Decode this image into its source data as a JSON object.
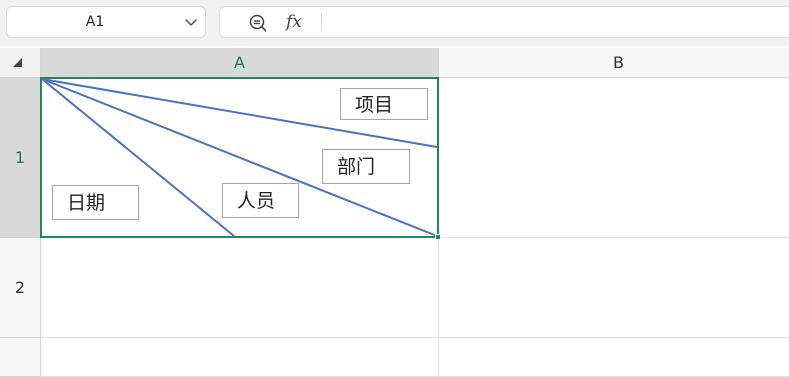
{
  "toolbar": {
    "name_box": "A1",
    "formula_value": ""
  },
  "grid": {
    "columns": [
      "A",
      "B"
    ],
    "rows": [
      "1",
      "2"
    ]
  },
  "textboxes": {
    "xiangmu": "项目",
    "bumen": "部门",
    "renyuan": "人员",
    "riqi": "日期"
  },
  "colors": {
    "selection": "#1e8a5c",
    "diagonal_lines": "#4a72c4",
    "active_header_text": "#1e7b4f"
  }
}
